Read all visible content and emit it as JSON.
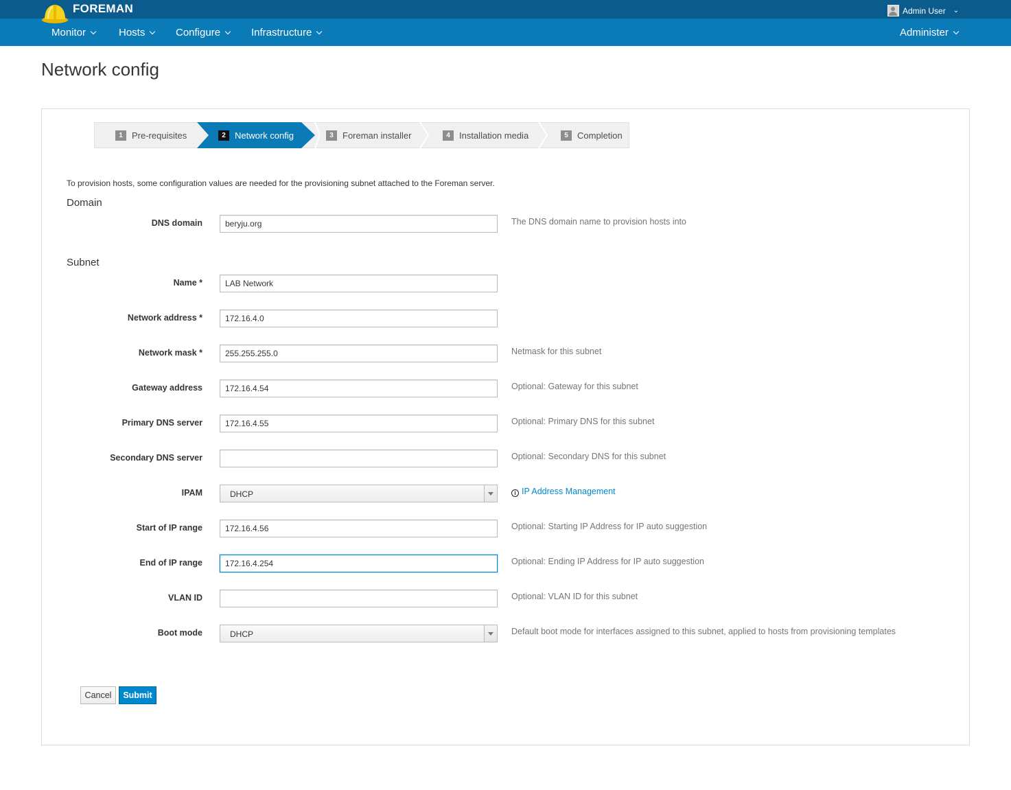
{
  "app": {
    "brand": "FOREMAN",
    "user": "Admin User",
    "nav": [
      "Monitor",
      "Hosts",
      "Configure",
      "Infrastructure"
    ],
    "nav_right": "Administer"
  },
  "page": {
    "title": "Network config"
  },
  "wizard": {
    "steps": [
      {
        "num": "1",
        "label": "Pre-requisites"
      },
      {
        "num": "2",
        "label": "Network config",
        "active": true
      },
      {
        "num": "3",
        "label": "Foreman installer"
      },
      {
        "num": "4",
        "label": "Installation media"
      },
      {
        "num": "5",
        "label": "Completion"
      }
    ]
  },
  "form": {
    "intro": "To provision hosts, some configuration values are needed for the provisioning subnet attached to the Foreman server.",
    "domain_legend": "Domain",
    "subnet_legend": "Subnet",
    "fields": {
      "dns_domain": {
        "label": "DNS domain",
        "value": "beryju.org",
        "help": "The DNS domain name to provision hosts into"
      },
      "name": {
        "label": "Name *",
        "value": "LAB Network"
      },
      "network_address": {
        "label": "Network address *",
        "value": "172.16.4.0"
      },
      "network_mask": {
        "label": "Network mask *",
        "value": "255.255.255.0",
        "help": "Netmask for this subnet"
      },
      "gateway": {
        "label": "Gateway address",
        "value": "172.16.4.54",
        "help": "Optional: Gateway for this subnet"
      },
      "primary_dns": {
        "label": "Primary DNS server",
        "value": "172.16.4.55",
        "help": "Optional: Primary DNS for this subnet"
      },
      "secondary_dns": {
        "label": "Secondary DNS server",
        "value": "",
        "help": "Optional: Secondary DNS for this subnet"
      },
      "ipam": {
        "label": "IPAM",
        "value": "DHCP",
        "help_link": "IP Address Management"
      },
      "ip_start": {
        "label": "Start of IP range",
        "value": "172.16.4.56",
        "help": "Optional: Starting IP Address for IP auto suggestion"
      },
      "ip_end": {
        "label": "End of IP range",
        "value": "172.16.4.254",
        "help": "Optional: Ending IP Address for IP auto suggestion"
      },
      "vlan": {
        "label": "VLAN ID",
        "value": "",
        "help": "Optional: VLAN ID for this subnet"
      },
      "boot_mode": {
        "label": "Boot mode",
        "value": "DHCP",
        "help": "Default boot mode for interfaces assigned to this subnet, applied to hosts from provisioning templates"
      }
    },
    "cancel_label": "Cancel",
    "submit_label": "Submit"
  }
}
